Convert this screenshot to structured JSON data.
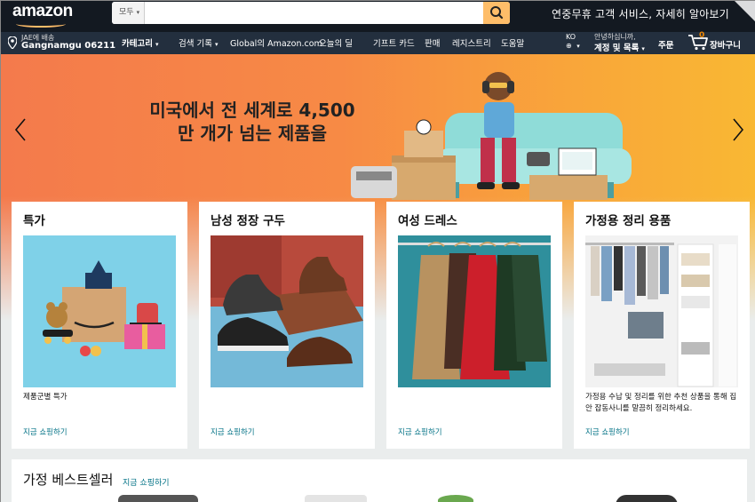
{
  "header": {
    "logo": "amazon",
    "search": {
      "category": "모두",
      "placeholder": ""
    },
    "promo": "연중무휴 고객 서비스, 자세히 알아보기"
  },
  "nav": {
    "location_line1": "JAE에 배송",
    "location_line2": "Gangnamgu 06211",
    "items": [
      {
        "label": "카테고리",
        "caret": "▾"
      },
      {
        "label": "검색 기록",
        "caret": "▾"
      },
      {
        "label": "Global의 Amazon.com"
      },
      {
        "label": "오늘의 딜"
      },
      {
        "label": "기프트 카드"
      },
      {
        "label": "판매"
      },
      {
        "label": "레지스트리"
      },
      {
        "label": "도움말"
      }
    ],
    "language": "KO",
    "language_icon": "globe-icon",
    "account_line1": "안녕하십니까,",
    "account_line2": "계정 및 목록",
    "orders": "주문",
    "cart_count": "0",
    "cart_label": "장바구니"
  },
  "hero": {
    "title_line1": "미국에서 전 세계로 4,500",
    "title_line2": "만 개가 넘는 제품을"
  },
  "cards": [
    {
      "title": "특가",
      "desc": "제품군별 특가",
      "link": "지금 쇼핑하기"
    },
    {
      "title": "남성 정장 구두",
      "desc": "",
      "link": "지금 쇼핑하기"
    },
    {
      "title": "여성 드레스",
      "desc": "",
      "link": "지금 쇼핑하기"
    },
    {
      "title": "가정용 정리 용품",
      "desc": "가정용 수납 및 정리를 위한 추천 상품을 통해 집안 잡동사니를 말끔히 정리하세요.",
      "link": "지금 쇼핑하기"
    }
  ],
  "bestsellers": {
    "title": "가정 베스트셀러",
    "link": "지금 쇼핑하기"
  },
  "colors": {
    "header_bg": "#131921",
    "nav_bg": "#232f3e",
    "accent": "#febd69",
    "link": "#007185"
  }
}
